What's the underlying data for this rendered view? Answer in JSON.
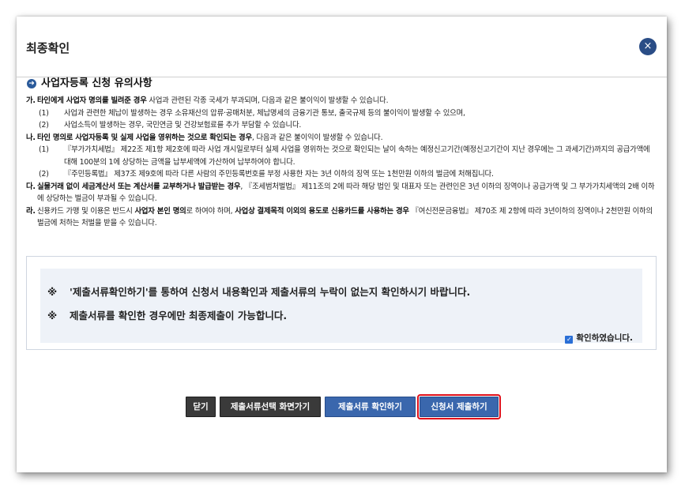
{
  "dialog": {
    "title": "최종확인",
    "close_icon": "×"
  },
  "section": {
    "bullet_icon": "➜",
    "heading": "사업자등록 신청 유의사항"
  },
  "notice": {
    "ga": {
      "marker": "가.",
      "bold": "타인에게 사업자 명의를 빌려준 경우",
      "rest": " 사업과 관련된 각종 국세가 부과되며, 다음과 같은 불이익이 발생할 수 있습니다.",
      "subs": [
        {
          "n": "(1)",
          "t": "사업과 관련한 체납이 발생하는 경우 소유재산의 압류·공매처분, 체납명세의 금융기관 통보, 출국규제 등의 불이익이 발생할 수 있으며,"
        },
        {
          "n": "(2)",
          "t": "사업소득이 발생하는 경우, 국민연금 및 건강보험료를 추가 부담할 수 있습니다."
        }
      ]
    },
    "na": {
      "marker": "나.",
      "bold": "타인 명의로 사업자등록 및 실제 사업을 영위하는 것으로 확인되는 경우",
      "rest": ", 다음과 같은 불이익이 발생할 수 있습니다.",
      "subs": [
        {
          "n": "(1)",
          "t": "『부가가치세법』 제22조 제1항 제2호에 따라 사업 개시일로부터 실제 사업을 영위하는 것으로 확인되는 날이 속하는 예정신고기간(예정신고기간이 지난 경우에는 그 과세기간)까지의 공급가액에 대해 100분의 1에 상당하는 금액을 납부세액에 가산하여 납부하여야 합니다."
        },
        {
          "n": "(2)",
          "t": "『주민등록법』 제37조 제9호에 따라 다른 사람의 주민등록번호를 부정 사용한 자는 3년 이하의 징역 또는 1천만원 이하의 벌금에 처해집니다."
        }
      ]
    },
    "da": {
      "marker": "다.",
      "bold": "실물거래 없이 세금계산서 또는 계산서를 교부하거나 발급받는 경우",
      "rest": ", 『조세범처벌법』 제11조의 2에 따라 해당 법인 및 대표자 또는 관련인은 3년 이하의 징역이나 공급가액 및 그 부가가치세액의 2배 이하에 상당하는 벌금이 부과될 수 있습니다."
    },
    "ra": {
      "marker": "라.",
      "pre": "신용카드 가맹 및 이용은 반드시 ",
      "bold1": "사업자 본인 명의",
      "mid": "로 하여야 하며, ",
      "bold2": "사업상 결제목적 이외의 용도로 신용카드를 사용하는 경우",
      "rest": " 『여신전문금융법』 제70조 제 2항에 따라 3년이하의 징역이나 2천만원 이하의 벌금에 처하는 처벌을 받을 수 있습니다."
    }
  },
  "confirm": {
    "symbol": "※",
    "line1": "'제출서류확인하기'를 통하여 신청서 내용확인과 제출서류의 누락이 없는지 확인하시기 바랍니다.",
    "line2": "제출서류를 확인한 경우에만 최종제출이 가능합니다.",
    "checkbox_label": "확인하였습니다.",
    "checkbox_checked": true
  },
  "buttons": {
    "close": "닫기",
    "go_select": "제출서류선택 화면가기",
    "check_docs": "제출서류 확인하기",
    "submit": "신청서 제출하기"
  },
  "colors": {
    "accent_blue": "#3a67ad",
    "dark_button": "#3a3a3a",
    "highlight_red": "#e0101a"
  }
}
